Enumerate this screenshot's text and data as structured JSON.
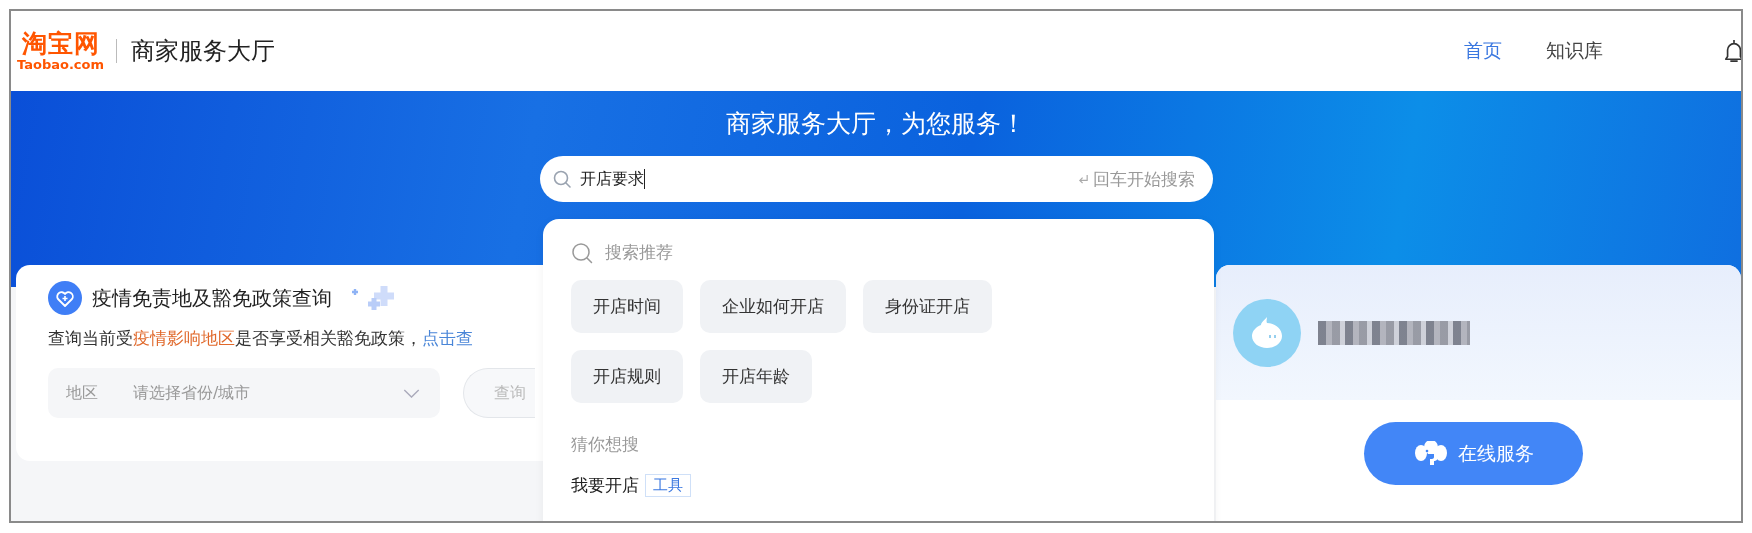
{
  "header": {
    "logo": {
      "mark": "淘宝网",
      "domain": "Taobao.com"
    },
    "title": "商家服务大厅",
    "nav": [
      {
        "label": "首页",
        "selected": true
      },
      {
        "label": "知识库",
        "selected": false
      }
    ]
  },
  "banner": {
    "heading": "商家服务大厅，为您服务！",
    "search": {
      "value": "开店要求",
      "hint": "回车开始搜索"
    }
  },
  "search_dropdown": {
    "recommend_title": "搜索推荐",
    "recommendations": [
      "开店时间",
      "企业如何开店",
      "身份证开店",
      "开店规则",
      "开店年龄"
    ],
    "guess_title": "猜你想搜",
    "guesses": [
      {
        "text": "我要开店",
        "tag": "工具"
      }
    ]
  },
  "policy_card": {
    "title": "疫情免责地及豁免政策查询",
    "description": {
      "before": "查询当前受",
      "highlight": "疫情影响地区",
      "after": "是否享受相关豁免政策，",
      "link": "点击查"
    },
    "region_field": {
      "label": "地区",
      "placeholder": "请选择省份/城市"
    },
    "query_button": {
      "label": "查询",
      "disabled": true
    }
  },
  "service_card": {
    "button": "在线服务"
  }
}
